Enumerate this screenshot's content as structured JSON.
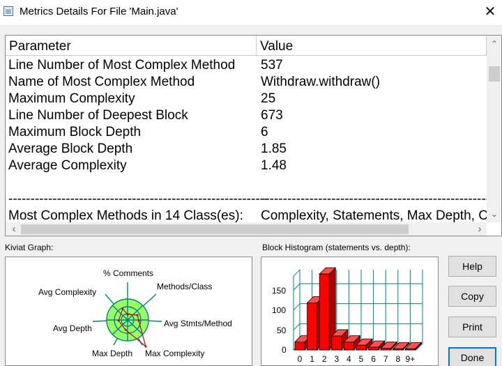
{
  "window": {
    "title": "Metrics Details For File 'Main.java'",
    "close_glyph": "✕"
  },
  "table": {
    "headers": [
      "Parameter",
      "Value"
    ],
    "rows": [
      {
        "parameter": "Line Number of Most Complex Method",
        "value": "537"
      },
      {
        "parameter": "Name of Most Complex Method",
        "value": "Withdraw.withdraw()"
      },
      {
        "parameter": "Maximum Complexity",
        "value": "25"
      },
      {
        "parameter": "Line Number of Deepest Block",
        "value": "673"
      },
      {
        "parameter": "Maximum Block Depth",
        "value": "6"
      },
      {
        "parameter": "Average Block Depth",
        "value": "1.85"
      },
      {
        "parameter": "Average Complexity",
        "value": "1.48"
      },
      {
        "parameter": "",
        "value": ""
      },
      {
        "parameter": "-----------------------------------------------------------",
        "value": "-----------------------------------------------------------"
      },
      {
        "parameter": "Most Complex Methods in 14 Class(es):",
        "value": "Complexity, Statements, Max Depth, Calls"
      }
    ]
  },
  "kiviat": {
    "label": "Kiviat Graph:",
    "axes": [
      "% Comments",
      "Methods/Class",
      "Avg Stmts/Method",
      "Max Complexity",
      "Max Depth",
      "Avg Depth",
      "Avg Complexity"
    ]
  },
  "histogram": {
    "label": "Block Histogram (statements vs. depth):",
    "y_ticks": [
      "150",
      "100",
      "50",
      "0"
    ],
    "x_labels": [
      "0",
      "1",
      "2",
      "3",
      "4",
      "5",
      "6",
      "7",
      "8",
      "9+"
    ]
  },
  "chart_data": {
    "type": "bar",
    "title": "Block Histogram (statements vs. depth):",
    "categories": [
      "0",
      "1",
      "2",
      "3",
      "4",
      "5",
      "6",
      "7",
      "8",
      "9+"
    ],
    "values": [
      20,
      118,
      190,
      35,
      20,
      12,
      7,
      4,
      3,
      3
    ],
    "ylim": [
      0,
      150
    ],
    "color": "#ff0000"
  },
  "buttons": {
    "help": "Help",
    "copy": "Copy",
    "print": "Print",
    "done": "Done"
  },
  "colors": {
    "bar": "#ff0000",
    "kiviat_fill": "#99ff66",
    "kiviat_line": "#008080",
    "accent": "#0078d7"
  }
}
